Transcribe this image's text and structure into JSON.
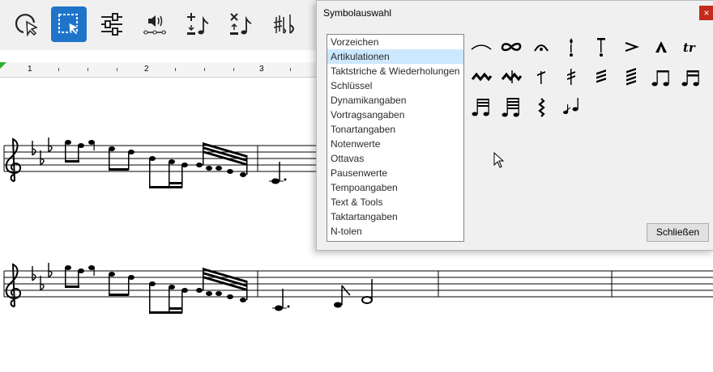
{
  "toolbar": {
    "buttons": [
      {
        "name": "pointer-tool-button",
        "icon": "pointer-lasso-icon"
      },
      {
        "name": "selection-tool-button",
        "icon": "selection-rectangle-icon",
        "active": true
      },
      {
        "name": "properties-button",
        "icon": "sliders-icon"
      },
      {
        "name": "playback-button",
        "icon": "speaker-icon"
      },
      {
        "name": "add-note-button",
        "icon": "plus-note-icon"
      },
      {
        "name": "delete-note-button",
        "icon": "cross-note-icon"
      },
      {
        "name": "accidentals-button",
        "icon": "sharp-flat-icon"
      }
    ],
    "accent": "#1f74c9"
  },
  "ruler": {
    "numbers": [
      "1",
      "2",
      "3"
    ]
  },
  "dialog": {
    "title": "Symbolauswahl",
    "close_glyph": "×",
    "categories": [
      "Vorzeichen",
      "Artikulationen",
      "Taktstriche & Wiederholungen",
      "Schlüssel",
      "Dynamikangaben",
      "Vortragsangaben",
      "Tonartangaben",
      "Notenwerte",
      "Ottavas",
      "Pausenwerte",
      "Tempoangaben",
      "Text & Tools",
      "Taktartangaben",
      "N-tolen"
    ],
    "selected_index": 1,
    "symbols": [
      "slur-icon",
      "turn-icon",
      "fermata-icon",
      "staccato-accent-icon",
      "tenuto-staccato-icon",
      "accent-icon",
      "marcato-icon",
      "trill-icon",
      "short-trill-icon",
      "mordent-icon",
      "stem-tremolo-icon",
      "double-tremolo-icon",
      "triple-tremolo-icon",
      "quad-tremolo-icon",
      "beamed-eighths-icon",
      "beamed-sixteenths-icon",
      "beamed-32nds-icon",
      "beamed-64ths-icon",
      "arpeggio-icon",
      "grace-note-icon"
    ],
    "trill_text": "tr",
    "close_button": "Schließen",
    "highlight": "#cce8ff"
  }
}
